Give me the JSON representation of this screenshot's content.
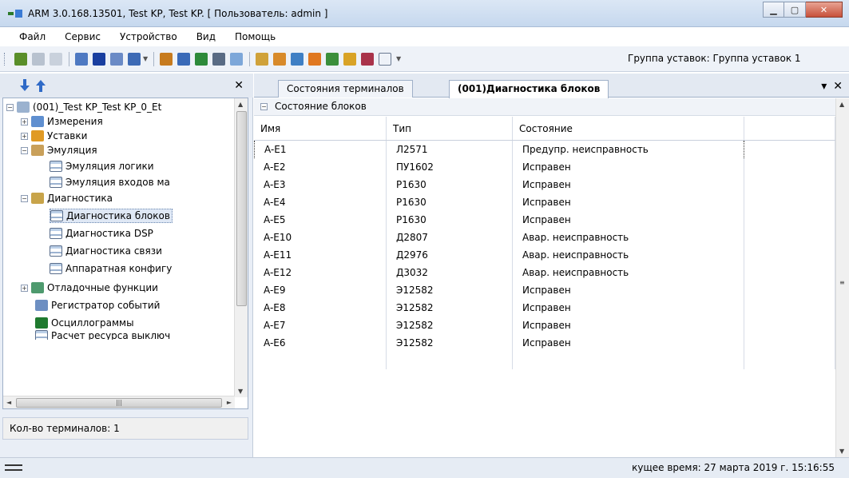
{
  "window": {
    "title": "ARM 3.0.168.13501, Test KP, Test KP. [ Пользователь: admin ]"
  },
  "menu": [
    "Файл",
    "Сервис",
    "Устройство",
    "Вид",
    "Помощь"
  ],
  "toolbar": {
    "group_label": "Группа уставок: Группа уставок 1"
  },
  "tree": {
    "items": [
      {
        "label": "(001)_Test KP_Test KP_0_Et"
      },
      {
        "label": "Измерения"
      },
      {
        "label": "Уставки"
      },
      {
        "label": "Эмуляция"
      },
      {
        "label": "Эмуляция логики"
      },
      {
        "label": "Эмуляция входов ма"
      },
      {
        "label": "Диагностика"
      },
      {
        "label": "Диагностика блоков"
      },
      {
        "label": "Диагностика DSP"
      },
      {
        "label": "Диагностика связи"
      },
      {
        "label": "Аппаратная конфигу"
      },
      {
        "label": "Отладочные функции"
      },
      {
        "label": "Регистратор событий"
      },
      {
        "label": "Осциллограммы"
      },
      {
        "label": "Расчет ресурса выключ"
      }
    ]
  },
  "left_footer": "Кол-во терминалов: 1",
  "tabs": [
    {
      "label": "Состояния терминалов"
    },
    {
      "label": "(001)Диагностика блоков"
    }
  ],
  "group_header": "Состояние блоков",
  "grid": {
    "columns": [
      "Имя",
      "Тип",
      "Состояние"
    ],
    "rows": [
      [
        "A-E1",
        "Л2571",
        "Предупр. неисправность"
      ],
      [
        "A-E2",
        "ПУ1602",
        "Исправен"
      ],
      [
        "A-E3",
        "P1630",
        "Исправен"
      ],
      [
        "A-E4",
        "P1630",
        "Исправен"
      ],
      [
        "A-E5",
        "P1630",
        "Исправен"
      ],
      [
        "A-E10",
        "Д2807",
        "Авар. неисправность"
      ],
      [
        "A-E11",
        "Д2976",
        "Авар. неисправность"
      ],
      [
        "A-E12",
        "Д3032",
        "Авар. неисправность"
      ],
      [
        "A-E9",
        "Э12582",
        "Исправен"
      ],
      [
        "A-E8",
        "Э12582",
        "Исправен"
      ],
      [
        "A-E7",
        "Э12582",
        "Исправен"
      ],
      [
        "A-E6",
        "Э12582",
        "Исправен"
      ]
    ]
  },
  "statusbar": {
    "time_text": "кущее время: 27 марта 2019 г. 15:16:55"
  }
}
